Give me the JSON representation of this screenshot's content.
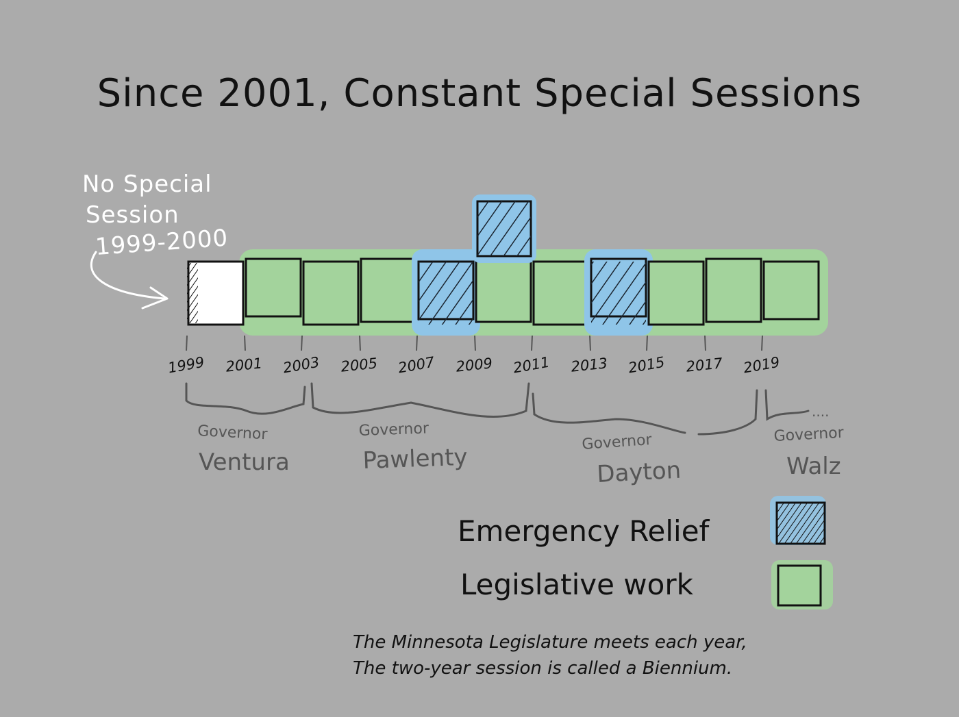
{
  "title": "Since 2001, Constant Special Sessions",
  "colors": {
    "background": "#ababab",
    "emergency_relief": "#8fc5e8",
    "legislative_work": "#a3d39c",
    "no_session": "#ffffff",
    "governor_text": "#555555"
  },
  "annotation": {
    "line1": "No Special",
    "line2": "Session",
    "line3": "1999-2000"
  },
  "chart_data": {
    "type": "bar",
    "title": "Since 2001, Constant Special Sessions",
    "x_ticks": [
      "1999",
      "2001",
      "2003",
      "2005",
      "2007",
      "2009",
      "2011",
      "2013",
      "2015",
      "2017",
      "2019"
    ],
    "categories": [
      "1999",
      "2001",
      "2003",
      "2005",
      "2007",
      "2009",
      "2011",
      "2013",
      "2015",
      "2017",
      "2019"
    ],
    "series": [
      {
        "name": "Legislative work",
        "values": [
          0,
          1,
          1,
          1,
          0,
          1,
          1,
          0,
          1,
          1,
          1
        ]
      },
      {
        "name": "Emergency Relief",
        "values": [
          0,
          0,
          0,
          0,
          1,
          1,
          0,
          1,
          0,
          0,
          0
        ]
      }
    ],
    "no_special_session": [
      "1999"
    ],
    "stacked": true,
    "grid": false,
    "legend_placement": "bottom-right"
  },
  "governors": [
    {
      "label": "Governor",
      "name": "Ventura"
    },
    {
      "label": "Governor",
      "name": "Pawlenty"
    },
    {
      "label": "Governor",
      "name": "Dayton"
    },
    {
      "label": "Governor",
      "name": "Walz"
    }
  ],
  "legend": {
    "emergency": "Emergency Relief",
    "legislative": "Legislative work"
  },
  "footnote": {
    "line1": "The Minnesota Legislature meets each year,",
    "line2": "The two-year session is called a Biennium."
  }
}
